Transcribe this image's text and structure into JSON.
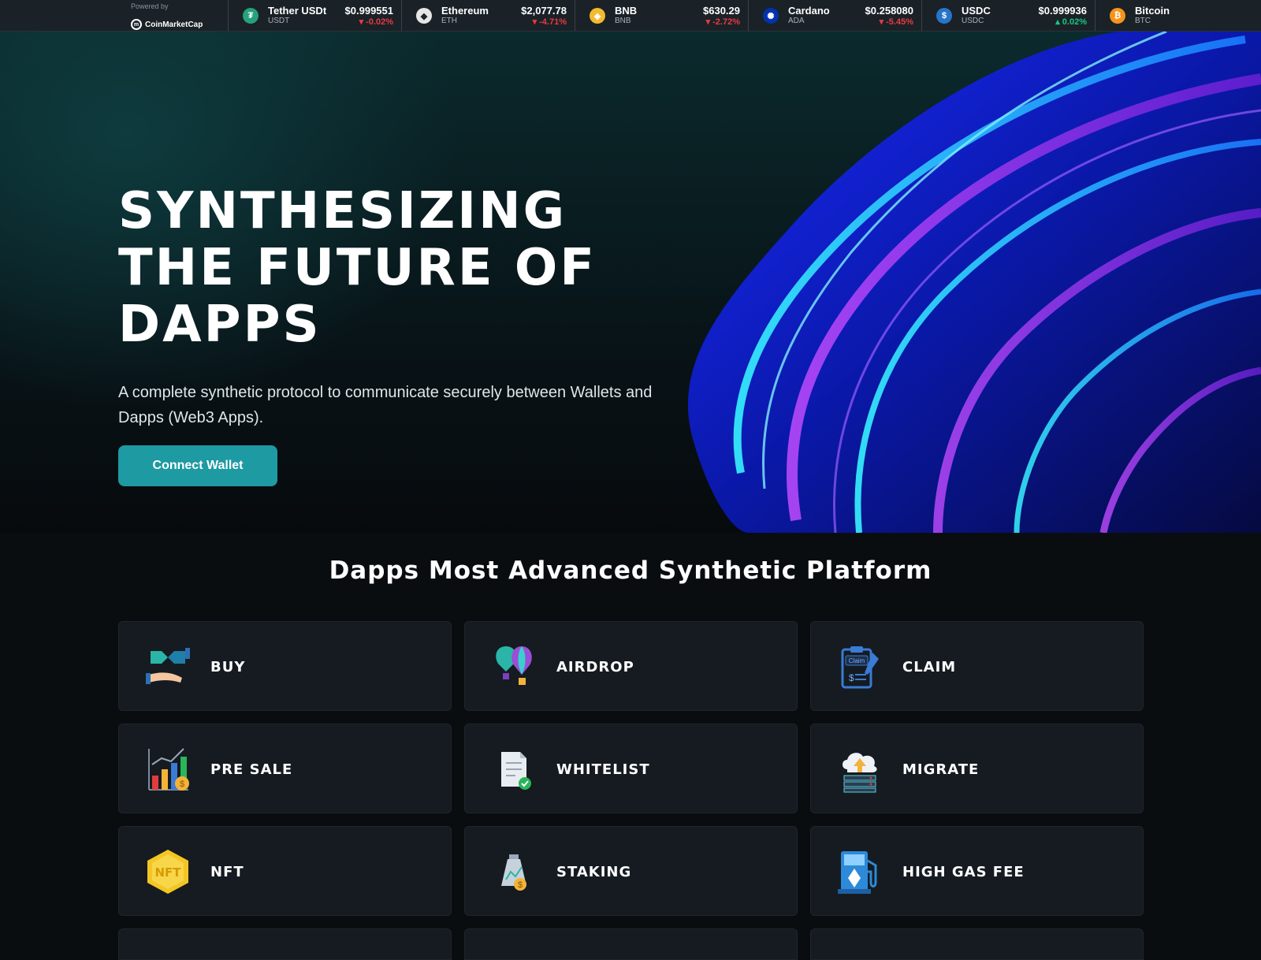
{
  "ticker": {
    "powered_by": "Powered by",
    "provider": "CoinMarketCap",
    "coins": [
      {
        "name": "Tether USDt",
        "symbol": "USDT",
        "price": "$0.999551",
        "change": "▾ -0.02%",
        "direction": "down",
        "icon_color": "#26a17b",
        "icon": "tether-icon",
        "glyph": "₮"
      },
      {
        "name": "Ethereum",
        "symbol": "ETH",
        "price": "$2,077.78",
        "change": "▾ -4.71%",
        "direction": "down",
        "icon_color": "#e6e6e6",
        "icon": "ethereum-icon",
        "glyph": "◆"
      },
      {
        "name": "BNB",
        "symbol": "BNB",
        "price": "$630.29",
        "change": "▾ -2.72%",
        "direction": "down",
        "icon_color": "#f3ba2f",
        "icon": "bnb-icon",
        "glyph": "◈"
      },
      {
        "name": "Cardano",
        "symbol": "ADA",
        "price": "$0.258080",
        "change": "▾ -5.45%",
        "direction": "down",
        "icon_color": "#0033ad",
        "icon": "cardano-icon",
        "glyph": "✺"
      },
      {
        "name": "USDC",
        "symbol": "USDC",
        "price": "$0.999936",
        "change": "▴ 0.02%",
        "direction": "up",
        "icon_color": "#2775ca",
        "icon": "usdc-icon",
        "glyph": "$"
      },
      {
        "name": "Bitcoin",
        "symbol": "BTC",
        "price": "",
        "change": "",
        "direction": "down",
        "icon_color": "#f7931a",
        "icon": "bitcoin-icon",
        "glyph": "₿"
      }
    ]
  },
  "hero": {
    "title": "SYNTHESIZING THE FUTURE OF DAPPS",
    "subtitle": "A complete synthetic protocol to communicate securely between Wallets and Dapps (Web3 Apps).",
    "cta_label": "Connect Wallet"
  },
  "features": {
    "title": "Dapps Most Advanced Synthetic Platform",
    "cards": [
      {
        "label": "BUY",
        "icon": "buy-handshake-icon"
      },
      {
        "label": "AIRDROP",
        "icon": "airdrop-balloon-icon"
      },
      {
        "label": "CLAIM",
        "icon": "claim-clipboard-icon"
      },
      {
        "label": "PRE SALE",
        "icon": "presale-chart-icon"
      },
      {
        "label": "WHITELIST",
        "icon": "whitelist-document-icon"
      },
      {
        "label": "MIGRATE",
        "icon": "migrate-cloud-icon"
      },
      {
        "label": "NFT",
        "icon": "nft-hexagon-icon"
      },
      {
        "label": "STAKING",
        "icon": "staking-bag-icon"
      },
      {
        "label": "HIGH GAS FEE",
        "icon": "gas-pump-icon"
      }
    ]
  }
}
